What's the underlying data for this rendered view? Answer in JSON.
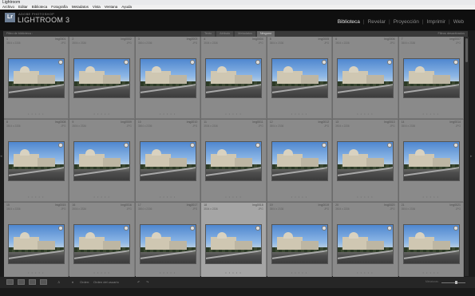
{
  "window": {
    "title": "Lightroom"
  },
  "menu": [
    "Archivo",
    "Editar",
    "Biblioteca",
    "Fotografía",
    "Metadatos",
    "Vista",
    "Ventana",
    "Ayuda"
  ],
  "identity": {
    "logo": "Lr",
    "small": "ADOBE PHOTOSHOP",
    "big": "LIGHTROOM 3"
  },
  "modules": [
    {
      "label": "Biblioteca",
      "active": true
    },
    {
      "label": "Revelar",
      "active": false
    },
    {
      "label": "Proyección",
      "active": false
    },
    {
      "label": "Imprimir",
      "active": false
    },
    {
      "label": "Web",
      "active": false
    }
  ],
  "filterbar": {
    "left": "Filtro de biblioteca :",
    "tabs": [
      {
        "label": "Texto",
        "on": false
      },
      {
        "label": "Atributo",
        "on": false
      },
      {
        "label": "Metadatos",
        "on": false
      },
      {
        "label": "Ninguno",
        "on": true
      }
    ],
    "right": "Filtros desactivados"
  },
  "grid": {
    "cells": [
      {
        "num": "1",
        "fname": "Img0001",
        "dims": "3504 x 2336",
        "ext": "JPG"
      },
      {
        "num": "2",
        "fname": "Img0002",
        "dims": "3504 x 2336",
        "ext": "JPG"
      },
      {
        "num": "3",
        "fname": "Img0003",
        "dims": "3504 x 2336",
        "ext": "JPG"
      },
      {
        "num": "4",
        "fname": "Img0004",
        "dims": "3504 x 2336",
        "ext": "JPG"
      },
      {
        "num": "5",
        "fname": "Img0005",
        "dims": "3504 x 2336",
        "ext": "JPG"
      },
      {
        "num": "6",
        "fname": "Img0006",
        "dims": "3504 x 2336",
        "ext": "JPG"
      },
      {
        "num": "7",
        "fname": "Img0007",
        "dims": "3504 x 2336",
        "ext": "JPG"
      },
      {
        "num": "8",
        "fname": "Img0008",
        "dims": "3504 x 2336",
        "ext": "JPG"
      },
      {
        "num": "9",
        "fname": "Img0009",
        "dims": "3504 x 2336",
        "ext": "JPG"
      },
      {
        "num": "10",
        "fname": "Img0010",
        "dims": "3504 x 2336",
        "ext": "JPG"
      },
      {
        "num": "11",
        "fname": "Img0011",
        "dims": "3504 x 2336",
        "ext": "JPG"
      },
      {
        "num": "12",
        "fname": "Img0012",
        "dims": "3504 x 2336",
        "ext": "JPG"
      },
      {
        "num": "13",
        "fname": "Img0013",
        "dims": "3504 x 2336",
        "ext": "JPG"
      },
      {
        "num": "14",
        "fname": "Img0014",
        "dims": "3504 x 2336",
        "ext": "JPG"
      },
      {
        "num": "15",
        "fname": "Img0015",
        "dims": "3504 x 2336",
        "ext": "JPG"
      },
      {
        "num": "16",
        "fname": "Img0016",
        "dims": "3504 x 2336",
        "ext": "JPG"
      },
      {
        "num": "17",
        "fname": "Img0017",
        "dims": "3504 x 2336",
        "ext": "JPG"
      },
      {
        "num": "18",
        "fname": "Img0018",
        "dims": "3504 x 2336",
        "ext": "JPG"
      },
      {
        "num": "19",
        "fname": "Img0019",
        "dims": "3504 x 2336",
        "ext": "JPG"
      },
      {
        "num": "20",
        "fname": "Img0020",
        "dims": "3504 x 2336",
        "ext": "JPG"
      },
      {
        "num": "21",
        "fname": "Img0021",
        "dims": "3504 x 2336",
        "ext": "JPG"
      }
    ],
    "selected_index": 17
  },
  "toolbar": {
    "sort_label": "Orden:",
    "sort_value": "Orden del usuario",
    "thumb_label": "Miniaturas"
  },
  "colors": {
    "accent": "#6d7f96",
    "panel": "#1b1b1b",
    "grid_bg": "#8a8a8a"
  }
}
